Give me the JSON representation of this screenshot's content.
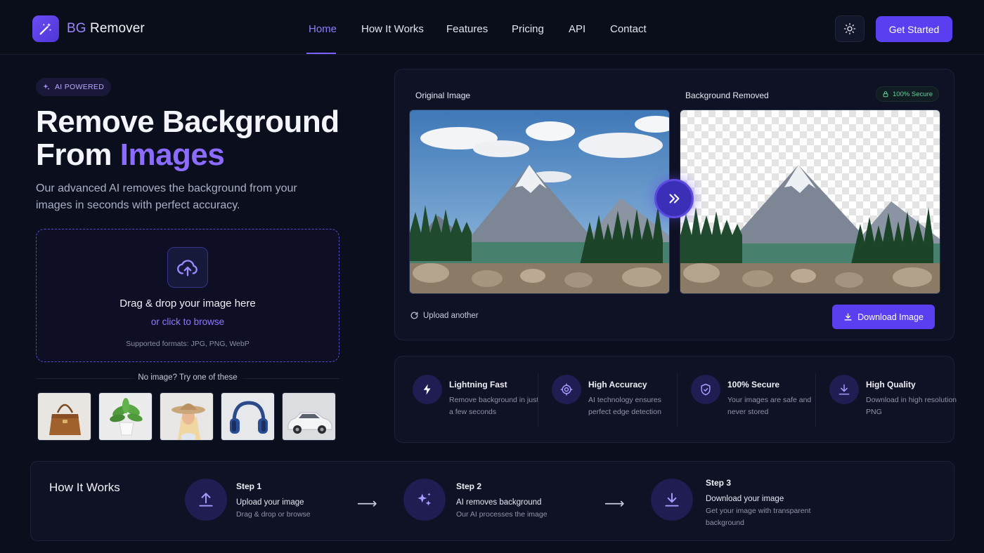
{
  "header": {
    "logo_icon": "magic-wand-icon",
    "logo_prefix": "BG",
    "logo_suffix": " Remover",
    "nav": [
      {
        "label": "Home",
        "active": true
      },
      {
        "label": "How It Works",
        "active": false
      },
      {
        "label": "Features",
        "active": false
      },
      {
        "label": "Pricing",
        "active": false
      },
      {
        "label": "API",
        "active": false
      },
      {
        "label": "Contact",
        "active": false
      }
    ],
    "theme_icon": "sun-icon",
    "cta_label": "Get Started"
  },
  "hero": {
    "badge": "AI POWERED",
    "badge_icon": "sparkles-icon",
    "title_line1": "Remove Background",
    "title_line2_prefix": "From ",
    "title_line2_highlight": "Images",
    "subtitle": "Our advanced AI removes the background from your images in seconds with perfect accuracy."
  },
  "dropzone": {
    "icon": "cloud-upload-icon",
    "title": "Drag & drop your image here",
    "link": "or click to browse",
    "formats": "Supported formats: JPG, PNG, WebP"
  },
  "samples": {
    "label": "No image? Try one of these",
    "items": [
      "handbag",
      "plant",
      "woman-in-hat",
      "headphones",
      "car"
    ]
  },
  "compare": {
    "original_label": "Original Image",
    "removed_label": "Background Removed",
    "secure_label": "100% Secure",
    "secure_icon": "lock-icon",
    "swap_icon": "double-chevron-right-icon",
    "upload_another": "Upload another",
    "download_label": "Download Image"
  },
  "features": [
    {
      "icon": "lightning-icon",
      "title": "Lightning Fast",
      "desc": "Remove background in just a few seconds"
    },
    {
      "icon": "target-icon",
      "title": "High Accuracy",
      "desc": "AI technology ensures perfect edge detection"
    },
    {
      "icon": "shield-icon",
      "title": "100% Secure",
      "desc": "Your images are safe and never stored"
    },
    {
      "icon": "download-icon",
      "title": "High Quality",
      "desc": "Download in high resolution PNG"
    }
  ],
  "how": {
    "title": "How It Works",
    "steps": [
      {
        "num": "Step 1",
        "title": "Upload your image",
        "desc": "Drag & drop or browse",
        "icon": "upload-icon"
      },
      {
        "num": "Step 2",
        "title": "AI removes background",
        "desc": "Our AI processes the image",
        "icon": "sparkles-icon"
      },
      {
        "num": "Step 3",
        "title": "Download your image",
        "desc": "Get your image with transparent background",
        "icon": "download-icon"
      }
    ],
    "arrow": "⟶"
  },
  "colors": {
    "background": "#0b0e1c",
    "accent": "#5a3ff0",
    "accent_text": "#8b6cff",
    "secure_green": "#5fd39a"
  }
}
